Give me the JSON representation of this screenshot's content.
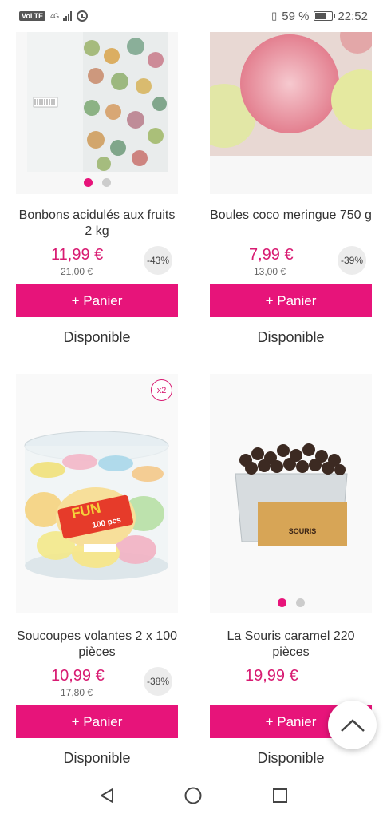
{
  "status_bar": {
    "volte": "VoLTE",
    "network": "4G",
    "battery_percent": "59 %",
    "battery_level": 0.59,
    "time": "22:52"
  },
  "products": [
    {
      "name": "Bonbons acidulés aux fruits 2 kg",
      "price": "11,99 €",
      "old_price": "21,00 €",
      "discount": "-43%",
      "button": "+ Panier",
      "availability": "Disponible",
      "image_dots": 2,
      "active_dot": 0
    },
    {
      "name": "Boules coco meringue 750 g",
      "price": "7,99 €",
      "old_price": "13,00 €",
      "discount": "-39%",
      "button": "+ Panier",
      "availability": "Disponible"
    },
    {
      "name": "Soucoupes volantes 2 x 100 pièces",
      "price": "10,99 €",
      "old_price": "17,80 €",
      "discount": "-38%",
      "badge": "x2",
      "product_label": "FUN",
      "product_sublabel": "100 pcs",
      "button": "+ Panier",
      "availability": "Disponible"
    },
    {
      "name": "La Souris caramel 220 pièces",
      "price": "19,99 €",
      "product_label": "SOURIS",
      "button": "+ Panier",
      "availability": "Disponible",
      "image_dots": 2,
      "active_dot": 0
    }
  ],
  "colors": {
    "accent": "#e7147a",
    "price": "#d81b72"
  },
  "icons": {
    "scroll_top": "chevron-up-icon",
    "nav_back": "back-triangle-icon",
    "nav_home": "home-circle-icon",
    "nav_recents": "recents-square-icon"
  }
}
